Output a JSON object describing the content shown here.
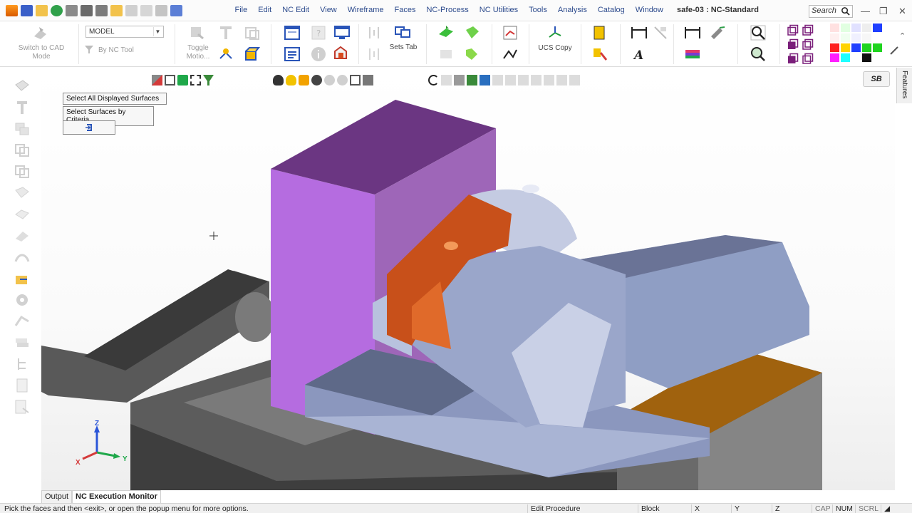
{
  "window": {
    "title": "safe-03 : NC-Standard",
    "search_placeholder": "Search"
  },
  "menu": [
    "File",
    "Edit",
    "NC Edit",
    "View",
    "Wireframe",
    "Faces",
    "NC-Process",
    "NC Utilities",
    "Tools",
    "Analysis",
    "Catalog",
    "Window"
  ],
  "ribbon": {
    "switch_to_cad": "Switch to CAD\nMode",
    "model_select": "MODEL",
    "by_nc_tool": "By NC Tool",
    "toggle_motion": "Toggle\nMotio...",
    "sets_tab": "Sets Tab",
    "ucs_copy": "UCS Copy"
  },
  "viewport": {
    "select_all_displayed": "Select All Displayed Surfaces",
    "select_by_criteria": "Select Surfaces by Criteria",
    "axis_x": "X",
    "axis_y": "Y",
    "axis_z": "Z"
  },
  "side_tab": "Features",
  "sb_badge": "SB",
  "bottom_tabs": [
    "Output",
    "NC Execution Monitor"
  ],
  "status": {
    "prompt": "Pick the faces and then <exit>, or open the popup menu for more options.",
    "edit_procedure": "Edit Procedure",
    "block": "Block",
    "x": "X",
    "y": "Y",
    "z": "Z",
    "cap": "CAP",
    "num": "NUM",
    "scrl": "SCRL"
  },
  "colors": {
    "accent_blue": "#2c4a8c",
    "selected_faces": "#c8501a",
    "stock_purple": "#b56ce0",
    "part_blue": "#8f9ec4",
    "vise_gray": "#6c6c6c",
    "brown_block": "#a0620e"
  },
  "palette": [
    "#ffe1e1",
    "#e1ffe1",
    "#e1e1ff",
    "#1f3fff",
    "#ff1f1f",
    "#ffd400",
    "#1fd41f",
    "#ff1fff",
    "#1fffff",
    "#111111"
  ]
}
